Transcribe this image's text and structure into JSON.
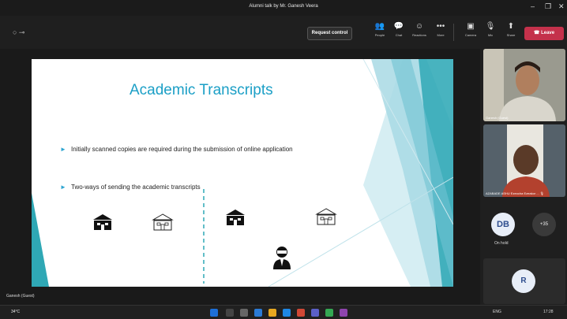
{
  "window": {
    "title": "Alumni talk by Mr. Ganesh Veera",
    "controls": [
      "–",
      "❐",
      "✕"
    ]
  },
  "toolbar": {
    "request_control": "Request control",
    "items": [
      {
        "label": "People",
        "icon": "people-icon",
        "glyph": "👥"
      },
      {
        "label": "Chat",
        "icon": "chat-icon",
        "glyph": "💬"
      },
      {
        "label": "Reactions",
        "icon": "reactions-icon",
        "glyph": "☺"
      },
      {
        "label": "More",
        "icon": "more-icon",
        "glyph": "•••"
      },
      {
        "label": "Camera",
        "icon": "camera-icon",
        "glyph": "▣"
      },
      {
        "label": "Mic",
        "icon": "mic-icon",
        "glyph": "🎙"
      },
      {
        "label": "Share",
        "icon": "share-icon",
        "glyph": "⬆"
      }
    ],
    "leave": "Leave"
  },
  "slide": {
    "title": "Academic Transcripts",
    "bullets": [
      "Initially scanned copies are required during the submission of online application",
      "Two-ways of sending the academic transcripts"
    ],
    "colors": {
      "accent": "#1b9fc6",
      "teal": "#2fa8b5"
    }
  },
  "presenter_name": "Ganesh (Guest)",
  "participants": {
    "tile1": "Ganesh (Guest)",
    "tile2": "AZABADE ASHU Ezeocha Ezeakor ... 🎙",
    "db_initials": "DB",
    "db_status": "On hold",
    "more_count": "+35",
    "r_initials": "R"
  },
  "taskbar": {
    "weather": "34°C",
    "lang": "ENG",
    "time": "17:28"
  }
}
